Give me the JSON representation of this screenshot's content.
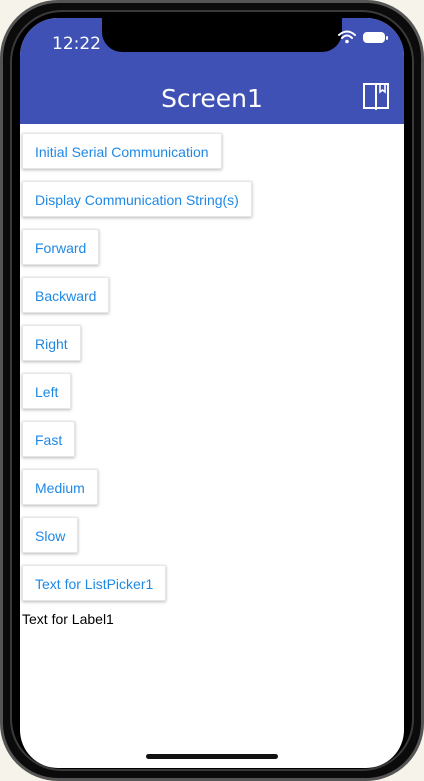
{
  "status_bar": {
    "time": "12:22"
  },
  "app_bar": {
    "title": "Screen1",
    "background_color": "#3f51b5",
    "icon": "book-icon"
  },
  "buttons": [
    {
      "label": "Initial Serial Communication"
    },
    {
      "label": "Display Communication String(s)"
    },
    {
      "label": "Forward"
    },
    {
      "label": "Backward"
    },
    {
      "label": "Right"
    },
    {
      "label": "Left"
    },
    {
      "label": "Fast"
    },
    {
      "label": "Medium"
    },
    {
      "label": "Slow"
    },
    {
      "label": "Text for ListPicker1"
    }
  ],
  "label1": {
    "text": "Text for Label1"
  },
  "colors": {
    "button_text": "#1e88e5",
    "accent": "#3f51b5"
  }
}
